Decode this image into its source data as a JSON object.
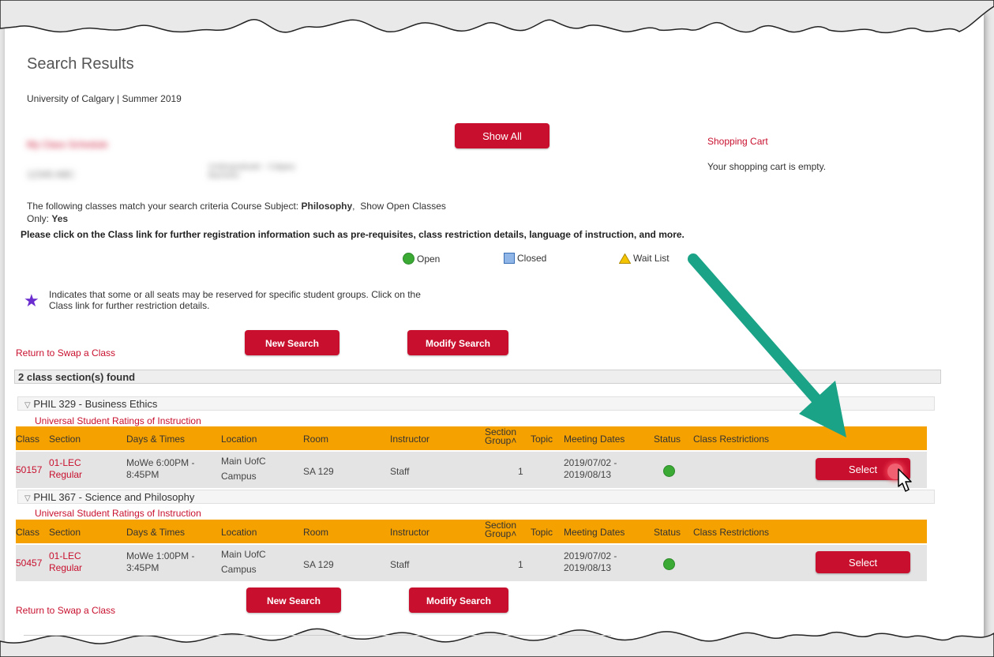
{
  "page": {
    "title": "Search Results",
    "subtitle": "University of Calgary | Summer 2019"
  },
  "header": {
    "show_all_label": "Show All",
    "redacted_name": "My Class Schedule",
    "redacted_id": "12345 ABC",
    "redacted_program": "Undergraduate - Calgary Bachelor",
    "shopping_cart_link": "Shopping Cart",
    "cart_status": "Your shopping cart is empty."
  },
  "criteria": {
    "prefix": "The following classes match your search criteria Course Subject:",
    "subject": "Philosophy",
    "open_label": "Show Open Classes",
    "only_label": "Only:",
    "only_value": "Yes",
    "instruction": "Please click on the Class link for further registration information such as pre-requisites, class restriction details, language of instruction, and more."
  },
  "legend": {
    "open": "Open",
    "closed": "Closed",
    "waitlist": "Wait List"
  },
  "reserved_note": {
    "line1": "Indicates that some or all seats may be reserved for specific student groups. Click on the",
    "line2": "Class link for further restriction details."
  },
  "actions": {
    "return_link": "Return to Swap a Class",
    "new_search": "New Search",
    "modify_search": "Modify Search"
  },
  "results": {
    "found_label": "2 class section(s) found",
    "ratings_link": "Universal Student Ratings of Instruction",
    "columns": {
      "class": "Class",
      "section": "Section",
      "days_times": "Days & Times",
      "location": "Location",
      "room": "Room",
      "instructor": "Instructor",
      "section_group_1": "Section",
      "section_group_2": "Group",
      "topic": "Topic",
      "meeting_dates": "Meeting Dates",
      "status": "Status",
      "restrictions": "Class Restrictions"
    },
    "courses": [
      {
        "title": "PHIL 329 - Business Ethics",
        "class_nbr": "50157",
        "section_1": "01-LEC",
        "section_2": "Regular",
        "days_1": "MoWe 6:00PM -",
        "days_2": "8:45PM",
        "location_1": "Main UofC",
        "location_2": "Campus",
        "room": "SA 129",
        "instructor": "Staff",
        "group": "1",
        "dates_1": "2019/07/02 -",
        "dates_2": "2019/08/13",
        "select_label": "Select"
      },
      {
        "title": "PHIL 367 - Science and Philosophy",
        "class_nbr": "50457",
        "section_1": "01-LEC",
        "section_2": "Regular",
        "days_1": "MoWe 1:00PM -",
        "days_2": "3:45PM",
        "location_1": "Main UofC",
        "location_2": "Campus",
        "room": "SA 129",
        "instructor": "Staff",
        "group": "1",
        "dates_1": "2019/07/02 -",
        "dates_2": "2019/08/13",
        "select_label": "Select"
      }
    ]
  },
  "colors": {
    "brand_red": "#c8102e",
    "header_orange": "#f5a100",
    "open_green": "#3aaa35",
    "arrow_teal": "#1aa386"
  }
}
